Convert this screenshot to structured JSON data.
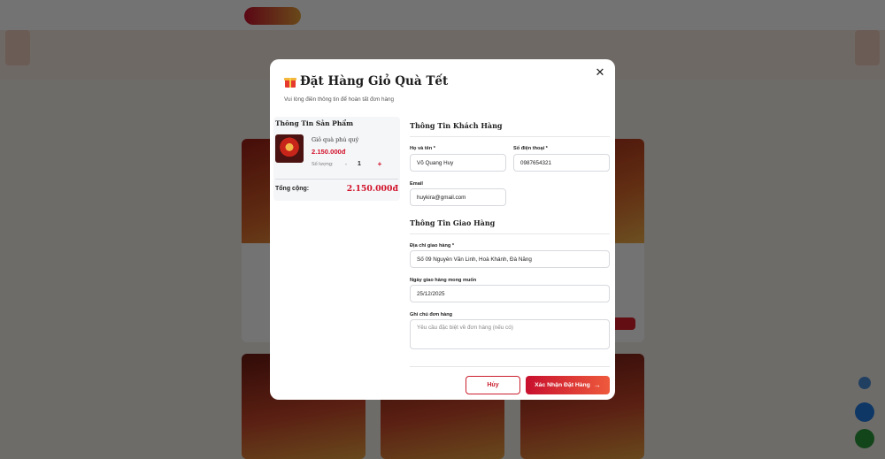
{
  "modal": {
    "title": "Đặt Hàng Giỏ Quà Tết",
    "subtitle": "Vui lòng điền thông tin để hoàn tất đơn hàng",
    "close_icon": "close-icon",
    "gift_icon": "gift-icon"
  },
  "product": {
    "section_title": "Thông Tin Sản Phẩm",
    "name": "Giỏ quà phú quý",
    "price": "2.150.000đ",
    "qty_label": "Số lượng:",
    "qty_minus": "-",
    "qty_value": "1",
    "qty_plus": "+",
    "total_label": "Tổng cộng:",
    "total_value": "2.150.000đ"
  },
  "customer": {
    "section_title": "Thông Tin Khách Hàng",
    "name_label": "Họ và tên *",
    "name_value": "Võ Quang Huy",
    "phone_label": "Số điện thoại *",
    "phone_value": "0987654321",
    "email_label": "Email",
    "email_value": "huykira@gmail.com"
  },
  "delivery": {
    "section_title": "Thông Tin Giao Hàng",
    "address_label": "Địa chỉ giao hàng *",
    "address_value": "Số 09 Nguyễn Văn Linh, Hoà Khánh, Đà Nẵng",
    "date_label": "Ngày giao hàng mong muốn",
    "date_value": "25/12/2025",
    "note_label": "Ghi chú đơn hàng",
    "note_placeholder": "Yêu cầu đặc biệt về đơn hàng (nếu có)"
  },
  "actions": {
    "cancel_label": "Hủy",
    "confirm_label": "Xác Nhận Đặt Hàng",
    "confirm_icon": "arrow-right-icon"
  },
  "colors": {
    "accent": "#d1122a",
    "overlay": "rgba(0,0,0,0.55)"
  }
}
